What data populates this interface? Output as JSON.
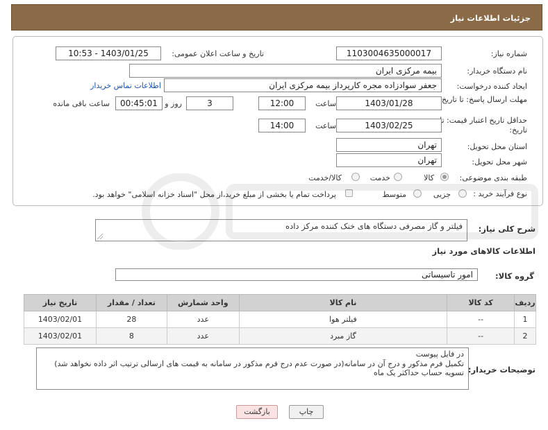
{
  "header": {
    "title": "جزئیات اطلاعات نیاز"
  },
  "form": {
    "need_number": {
      "label": "شماره نیاز:",
      "value": "1103004635000017"
    },
    "announce_datetime": {
      "label": "تاریخ و ساعت اعلان عمومی:",
      "value": "1403/01/25 - 10:53"
    },
    "buyer_org": {
      "label": "نام دستگاه خریدار:",
      "value": "بیمه مرکزی ایران"
    },
    "requester": {
      "label": "ایجاد کننده درخواست:",
      "value": "جعفر سوادزاده مجره کارپرداز بیمه مرکزی ایران",
      "contact_link": "اطلاعات تماس خریدار"
    },
    "reply_deadline": {
      "label": "مهلت ارسال پاسخ: تا تاریخ:",
      "date": "1403/01/28",
      "time_label": "ساعت",
      "time": "12:00",
      "days": "3",
      "days_label": "روز و",
      "remaining": "00:45:01",
      "remaining_label": "ساعت باقی مانده"
    },
    "price_validity": {
      "label": "حداقل تاریخ اعتبار قیمت: تا تاریخ:",
      "date": "1403/02/25",
      "time_label": "ساعت",
      "time": "14:00"
    },
    "delivery_province": {
      "label": "استان محل تحویل:",
      "value": "تهران"
    },
    "delivery_city": {
      "label": "شهر محل تحویل:",
      "value": "تهران"
    },
    "category": {
      "label": "طبقه بندی موضوعی:",
      "options": [
        "کالا",
        "خدمت",
        "کالا/خدمت"
      ],
      "selected": "کالا"
    },
    "process_type": {
      "label": "نوع فرآیند خرید :",
      "options": [
        "جزیی",
        "متوسط"
      ],
      "note": "پرداخت تمام یا بخشی از مبلغ خرید،از محل \"اسناد خزانه اسلامی\" خواهد بود."
    }
  },
  "description": {
    "label": "شرح کلی نیاز:",
    "value": "فیلتر و گاز مصرفی دستگاه های خنک کننده مرکز داده"
  },
  "items_section": {
    "title": "اطلاعات کالاهای مورد نیاز",
    "group_label": "گروه کالا:",
    "group_value": "امور تاسیساتی"
  },
  "table": {
    "headers": [
      "ردیف",
      "کد کالا",
      "نام کالا",
      "واحد شمارش",
      "تعداد / مقدار",
      "تاریخ نیاز"
    ],
    "rows": [
      [
        "1",
        "--",
        "فیلتر هوا",
        "عدد",
        "28",
        "1403/02/01"
      ],
      [
        "2",
        "--",
        "گاز مبرد",
        "عدد",
        "8",
        "1403/02/01"
      ]
    ]
  },
  "buyer_notes": {
    "label": "توضیحات خریدار:",
    "lines": [
      "در فایل پیوست",
      "تکمیل فرم مذکور و درج آن در سامانه(در صورت عدم درج فرم مذکور در سامانه به قیمت های ارسالی ترتیب اثر داده نخواهد شد)",
      "تسویه حساب حداکثر یک ماه"
    ]
  },
  "buttons": {
    "print": "چاپ",
    "back": "بازگشت"
  },
  "colors": {
    "title_bg": "#8b6b47",
    "link": "#1a55b8",
    "back_btn_bg": "#fbe3e3"
  }
}
